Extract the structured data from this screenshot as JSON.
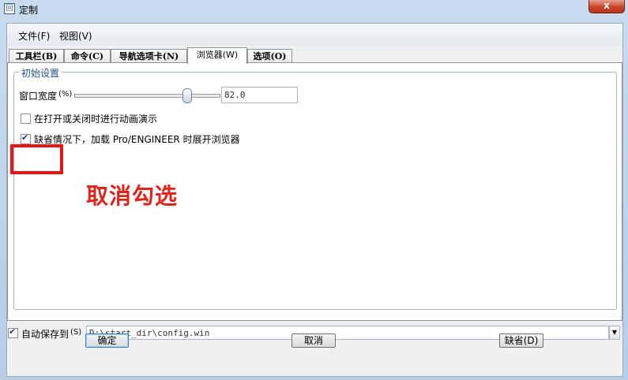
{
  "window": {
    "title": "定制",
    "close_label": "x"
  },
  "menu": {
    "items": [
      "文件(F)",
      "视图(V)"
    ]
  },
  "tabs": [
    {
      "label": "工具栏(B)"
    },
    {
      "label": "命令(C)"
    },
    {
      "label": "导航选项卡(N)"
    },
    {
      "label": "浏览器(W)"
    },
    {
      "label": "选项(O)"
    }
  ],
  "active_tab_index": 3,
  "browser_panel": {
    "group_title": "初始设置",
    "width_label": "窗口宽度",
    "width_unit": "(%)",
    "width_value": "82.0",
    "width_percent": 82.0,
    "animate_label": "在打开或关闭时进行动画演示",
    "animate_checked": false,
    "load_label": "缺省情况下，加载 Pro/ENGINEER 时展开浏览器",
    "load_checked": true
  },
  "annotation": {
    "text": "取消勾选",
    "color": "#e3231a"
  },
  "autosave": {
    "label": "自动保存到",
    "shortcut": "(S)",
    "checked": true,
    "path": "D:\\start_dir\\config.win"
  },
  "buttons": {
    "ok": "确定",
    "cancel": "取消",
    "default": "缺省(D)"
  }
}
